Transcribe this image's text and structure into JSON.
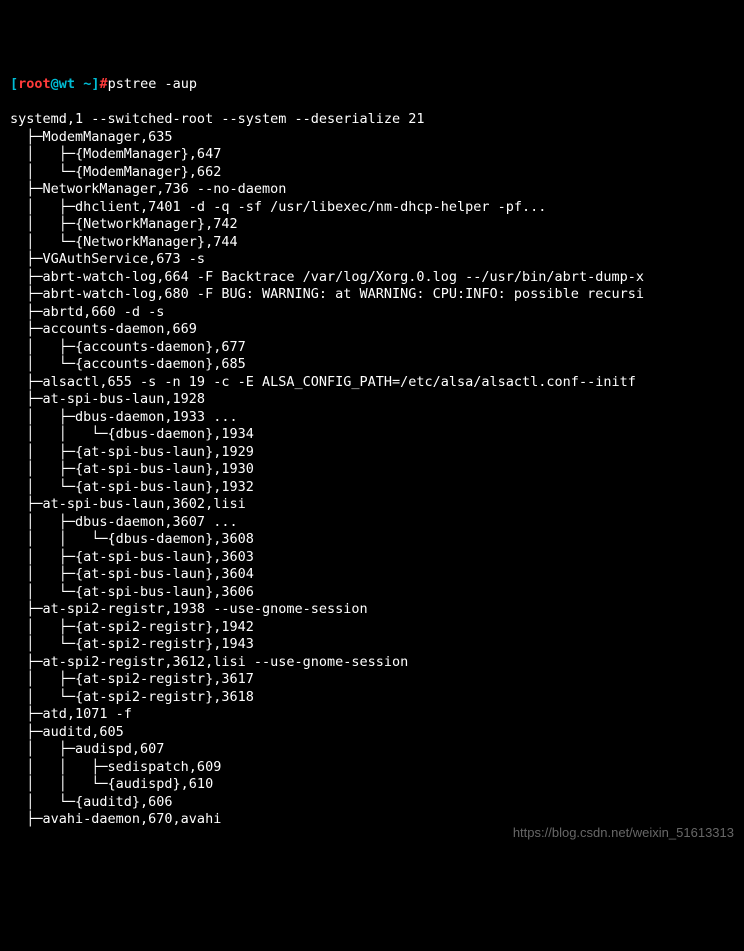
{
  "prompt": {
    "user": "root",
    "at": "@",
    "host": "wt",
    "dir": "~",
    "command": "pstree -aup"
  },
  "lines": [
    "systemd,1 --switched-root --system --deserialize 21",
    "  ├─ModemManager,635",
    "  │   ├─{ModemManager},647",
    "  │   └─{ModemManager},662",
    "  ├─NetworkManager,736 --no-daemon",
    "  │   ├─dhclient,7401 -d -q -sf /usr/libexec/nm-dhcp-helper -pf...",
    "  │   ├─{NetworkManager},742",
    "  │   └─{NetworkManager},744",
    "  ├─VGAuthService,673 -s",
    "  ├─abrt-watch-log,664 -F Backtrace /var/log/Xorg.0.log --/usr/bin/abrt-dump-x",
    "  ├─abrt-watch-log,680 -F BUG: WARNING: at WARNING: CPU:INFO: possible recursi",
    "  ├─abrtd,660 -d -s",
    "  ├─accounts-daemon,669",
    "  │   ├─{accounts-daemon},677",
    "  │   └─{accounts-daemon},685",
    "  ├─alsactl,655 -s -n 19 -c -E ALSA_CONFIG_PATH=/etc/alsa/alsactl.conf--initf",
    "  ├─at-spi-bus-laun,1928",
    "  │   ├─dbus-daemon,1933 ...",
    "  │   │   └─{dbus-daemon},1934",
    "  │   ├─{at-spi-bus-laun},1929",
    "  │   ├─{at-spi-bus-laun},1930",
    "  │   └─{at-spi-bus-laun},1932",
    "  ├─at-spi-bus-laun,3602,lisi",
    "  │   ├─dbus-daemon,3607 ...",
    "  │   │   └─{dbus-daemon},3608",
    "  │   ├─{at-spi-bus-laun},3603",
    "  │   ├─{at-spi-bus-laun},3604",
    "  │   └─{at-spi-bus-laun},3606",
    "  ├─at-spi2-registr,1938 --use-gnome-session",
    "  │   ├─{at-spi2-registr},1942",
    "  │   └─{at-spi2-registr},1943",
    "  ├─at-spi2-registr,3612,lisi --use-gnome-session",
    "  │   ├─{at-spi2-registr},3617",
    "  │   └─{at-spi2-registr},3618",
    "  ├─atd,1071 -f",
    "  ├─auditd,605",
    "  │   ├─audispd,607",
    "  │   │   ├─sedispatch,609",
    "  │   │   └─{audispd},610",
    "  │   └─{auditd},606",
    "  ├─avahi-daemon,670,avahi"
  ],
  "watermark": "https://blog.csdn.net/weixin_51613313"
}
